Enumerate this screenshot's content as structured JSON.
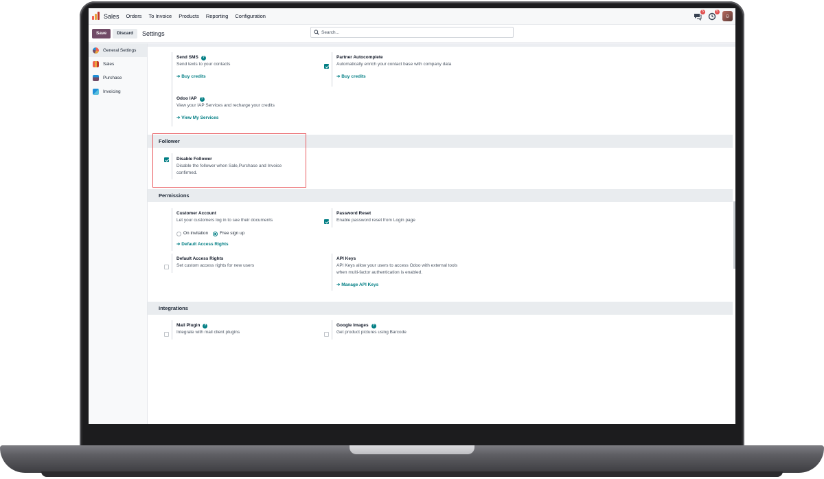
{
  "app": {
    "title": "Sales",
    "menu": [
      "Orders",
      "To Invoice",
      "Products",
      "Reporting",
      "Configuration"
    ],
    "chat_badge": "5",
    "activity_badge": "5"
  },
  "control": {
    "save": "Save",
    "discard": "Discard",
    "title": "Settings",
    "search_placeholder": "Search..."
  },
  "sidebar": {
    "items": [
      {
        "label": "General Settings",
        "icon": "general-settings-icon",
        "color": "#f06050"
      },
      {
        "label": "Sales",
        "icon": "sales-icon",
        "color": "#e8a33d"
      },
      {
        "label": "Purchase",
        "icon": "purchase-icon",
        "color": "#714b67"
      },
      {
        "label": "Invoicing",
        "icon": "invoicing-icon",
        "color": "#1f8fd8"
      }
    ]
  },
  "top_settings": {
    "send_sms": {
      "title": "Send SMS",
      "desc": "Send texts to your contacts",
      "link": "Buy credits"
    },
    "partner_autocomplete": {
      "title": "Partner Autocomplete",
      "desc": "Automatically enrich your contact base with company data",
      "link": "Buy credits"
    },
    "odoo_iap": {
      "title": "Odoo IAP",
      "desc": "View your IAP Services and recharge your credits",
      "link": "View My Services"
    }
  },
  "follower": {
    "header": "Follower",
    "disable_follower": {
      "title": "Disable Follower",
      "desc1": "Disable the follower when Sale,Purchase and Invoice",
      "desc2": "confirmed."
    }
  },
  "permissions": {
    "header": "Permissions",
    "customer_account": {
      "title": "Customer Account",
      "desc": "Let your customers log in to see their documents",
      "opt1": "On invitation",
      "opt2": "Free sign up",
      "link": "Default Access Rights"
    },
    "password_reset": {
      "title": "Password Reset",
      "desc": "Enable password reset from Login page"
    },
    "default_access": {
      "title": "Default Access Rights",
      "desc": "Set custom access rights for new users"
    },
    "api_keys": {
      "title": "API Keys",
      "desc1": "API Keys allow your users to access Odoo with external tools",
      "desc2": "when multi-factor authentication is enabled.",
      "link": "Manage API Keys"
    }
  },
  "integrations": {
    "header": "Integrations",
    "mail_plugin": {
      "title": "Mail Plugin",
      "desc": "Integrate with mail client plugins"
    },
    "google_images": {
      "title": "Google Images",
      "desc": "Get product pictures using Barcode"
    }
  },
  "colors": {
    "brand": "#714b67",
    "accent": "#017e84",
    "highlight": "#e95a5f"
  },
  "arrow": "➔"
}
